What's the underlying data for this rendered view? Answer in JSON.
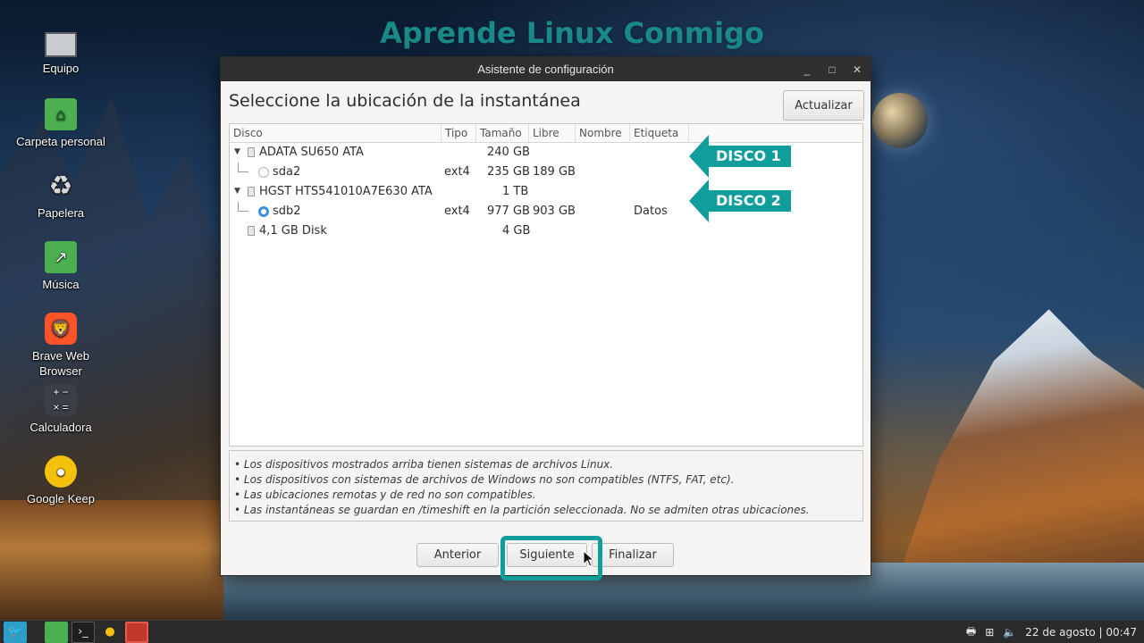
{
  "watermark": "Aprende Linux Conmigo",
  "desktop_icons": [
    {
      "label": "Equipo",
      "icon": "computer-icon"
    },
    {
      "label": "Carpeta personal",
      "icon": "home-folder-icon"
    },
    {
      "label": "Papelera",
      "icon": "trash-icon"
    },
    {
      "label": "Música",
      "icon": "music-folder-icon"
    },
    {
      "label": "Brave Web Browser",
      "icon": "brave-icon"
    },
    {
      "label": "Calculadora",
      "icon": "calculator-icon"
    },
    {
      "label": "Google Keep",
      "icon": "keep-bulb-icon"
    }
  ],
  "window": {
    "title": "Asistente de configuración",
    "heading": "Seleccione la ubicación de la instantánea",
    "refresh_label": "Actualizar",
    "columns": [
      "Disco",
      "Tipo",
      "Tamaño",
      "Libre",
      "Nombre",
      "Etiqueta"
    ],
    "rows": [
      {
        "disk": "ADATA SU650 ATA",
        "type": "",
        "size": "240 GB",
        "free": "",
        "name": "",
        "label": "",
        "kind": "disk"
      },
      {
        "disk": "sda2",
        "type": "ext4",
        "size": "235 GB",
        "free": "189 GB",
        "name": "",
        "label": "",
        "kind": "partition",
        "selected": false
      },
      {
        "disk": "HGST HTS541010A7E630 ATA",
        "type": "",
        "size": "1 TB",
        "free": "",
        "name": "",
        "label": "",
        "kind": "disk"
      },
      {
        "disk": "sdb2",
        "type": "ext4",
        "size": "977 GB",
        "free": "903 GB",
        "name": "",
        "label": "Datos",
        "kind": "partition",
        "selected": true
      },
      {
        "disk": "4,1 GB Disk",
        "type": "",
        "size": "4 GB",
        "free": "",
        "name": "",
        "label": "",
        "kind": "disk-plain"
      }
    ],
    "notes": [
      "• Los dispositivos mostrados arriba tienen sistemas de archivos Linux.",
      "• Los dispositivos con sistemas de archivos de Windows no son compatibles (NTFS, FAT, etc).",
      "• Las ubicaciones remotas y de red no son compatibles.",
      "• Las instantáneas se guardan en /timeshift en la partición seleccionada. No se admiten otras ubicaciones."
    ],
    "buttons": {
      "prev": "Anterior",
      "next": "Siguiente",
      "finish": "Finalizar"
    }
  },
  "callouts": {
    "disk1": "DISCO 1",
    "disk2": "DISCO 2"
  },
  "taskbar": {
    "clock": "22 de agosto | 00:47"
  },
  "colors": {
    "accent": "#0f9e9b",
    "titlebar": "#2f2f2f",
    "radio_selected": "#3f8fd6"
  }
}
